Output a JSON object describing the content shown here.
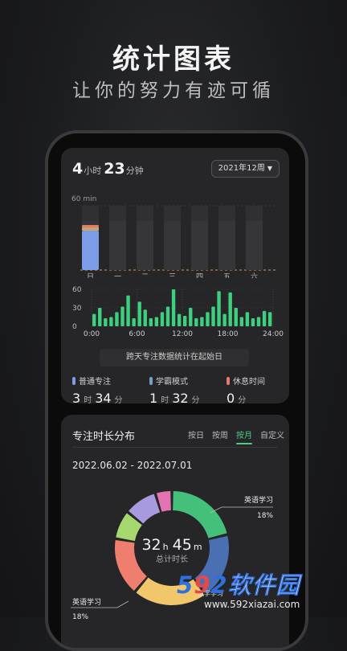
{
  "hero": {
    "title": "统计图表",
    "subtitle": "让你的努力有迹可循"
  },
  "summary": {
    "hours": "4",
    "hours_unit": "小时",
    "minutes": "23",
    "minutes_unit": "分钟",
    "week_select": "2021年12周"
  },
  "chart_data": [
    {
      "type": "bar",
      "ylabel": "60 min",
      "categories": [
        "日",
        "一",
        "二",
        "三",
        "四",
        "五",
        "六"
      ],
      "series": [
        {
          "values": [
            42,
            0,
            0,
            0,
            0,
            0,
            0
          ]
        }
      ],
      "ylim": [
        0,
        60
      ],
      "colors": [
        "#7b9de8",
        "#c5a56b",
        "#e77a6b"
      ]
    },
    {
      "type": "bar",
      "x_ticks": [
        "0:00",
        "6:00",
        "12:00",
        "18:00",
        "24:00"
      ],
      "y_ticks": [
        "60",
        "30",
        "0"
      ],
      "ylim": [
        0,
        60
      ],
      "values": [
        20,
        30,
        13,
        15,
        23,
        32,
        50,
        13,
        40,
        27,
        13,
        15,
        23,
        32,
        60,
        20,
        17,
        30,
        13,
        15,
        23,
        32,
        57,
        20,
        55,
        30,
        15,
        23,
        13,
        15,
        25,
        23
      ],
      "color": "#3ecf7f"
    },
    {
      "type": "pie",
      "title": "",
      "center_hours": "32",
      "center_hours_unit": "h",
      "center_minutes": "45",
      "center_minutes_unit": "m",
      "center_label": "总计时长",
      "slices": [
        {
          "label": "英语学习",
          "value": 18,
          "color": "#45c07a"
        },
        {
          "label": "数学学习",
          "value": 16,
          "color": "#4a6fb3"
        },
        {
          "label": "英语学习",
          "value": 18,
          "color": "#f2c66b"
        },
        {
          "label": "",
          "value": 14,
          "color": "#f07e6e"
        },
        {
          "label": "",
          "value": 7,
          "color": "#a5d86e"
        },
        {
          "label": "",
          "value": 8,
          "color": "#a99ae0"
        },
        {
          "label": "",
          "value": 4,
          "color": "#e473b3"
        }
      ],
      "callouts": [
        {
          "name": "英语学习",
          "pct": "18%"
        },
        {
          "name": "英语学习",
          "pct": "18%"
        }
      ]
    }
  ],
  "notice": "跨天专注数据统计在起始日",
  "stats": [
    {
      "label": "普通专注",
      "value_a": "3",
      "unit_a": "时",
      "value_b": "34",
      "unit_b": "分",
      "color": "#7b9de8"
    },
    {
      "label": "学霸模式",
      "value_a": "1",
      "unit_a": "时",
      "value_b": "32",
      "unit_b": "分",
      "color": "#6fa3c8"
    },
    {
      "label": "休息时间",
      "value_a": "0",
      "unit_a": "分",
      "color": "#e77a6b"
    }
  ],
  "distribution": {
    "title": "专注时长分布",
    "tabs": [
      "按日",
      "按周",
      "按月",
      "自定义"
    ],
    "active_tab": "按月",
    "date_range": "2022.06.02 - 2022.07.01"
  },
  "watermark": {
    "n1": "5",
    "n2": "9",
    "n3": "2",
    "text": "软件园",
    "url": "www.592xiazai.com"
  }
}
